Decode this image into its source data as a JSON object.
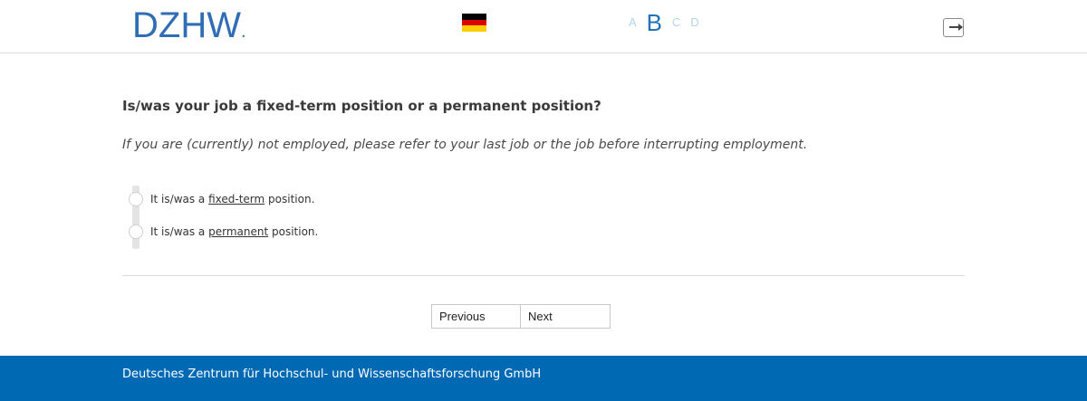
{
  "header": {
    "logo_text": "DZHW",
    "logo_dot": ".",
    "language_flag": "german-flag-icon",
    "flag_colors": [
      "#000000",
      "#dd0000",
      "#ffce00"
    ],
    "progress_letters": [
      "A",
      "B",
      "C",
      "D"
    ],
    "active_letter_index": 1,
    "exit_icon": "exit-icon"
  },
  "question": {
    "title": "Is/was your job a fixed-term position or a permanent position?",
    "instruction": "If you are (currently) not employed, please refer to your last job or the job before interrupting employment."
  },
  "options": [
    {
      "prefix": "It is/was a ",
      "emphasis": "fixed-term",
      "suffix": " position."
    },
    {
      "prefix": "It is/was a ",
      "emphasis": "permanent",
      "suffix": " position."
    }
  ],
  "navigation": {
    "previous_label": "Previous",
    "next_label": "Next"
  },
  "footer": {
    "text": "Deutsches Zentrum für Hochschul- und Wissenschaftsforschung GmbH"
  },
  "colors": {
    "brand_blue": "#2f6db5",
    "footer_blue": "#0069b4",
    "letter_inactive": "#b5d3ea",
    "letter_active": "#1f74b8"
  }
}
